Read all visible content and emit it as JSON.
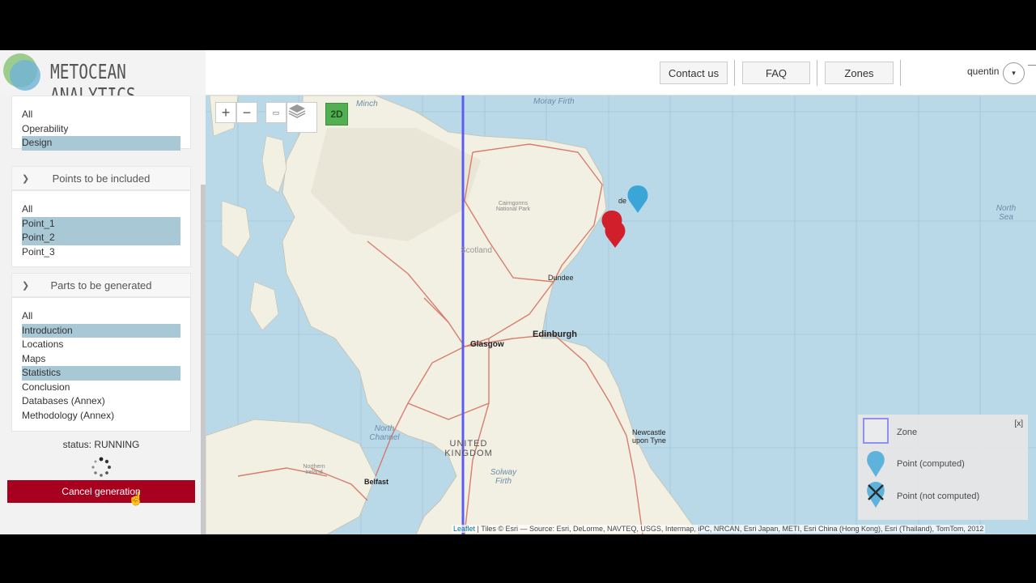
{
  "header": {
    "app_title": "METOCEAN ANALYTICS",
    "buttons": [
      "Contact us",
      "FAQ",
      "Zones"
    ],
    "username": "quentin"
  },
  "sidebar": {
    "type_options": [
      {
        "label": "All",
        "selected": false
      },
      {
        "label": "Operability",
        "selected": false
      },
      {
        "label": "Design",
        "selected": true
      }
    ],
    "points_panel": {
      "title": "Points to be included",
      "options": [
        {
          "label": "All",
          "selected": false
        },
        {
          "label": "Point_1",
          "selected": true
        },
        {
          "label": "Point_2",
          "selected": true
        },
        {
          "label": "Point_3",
          "selected": false
        }
      ]
    },
    "parts_panel": {
      "title": "Parts to be generated",
      "options": [
        {
          "label": "All",
          "selected": false
        },
        {
          "label": "Introduction",
          "selected": true
        },
        {
          "label": "Locations",
          "selected": false
        },
        {
          "label": "Maps",
          "selected": false
        },
        {
          "label": "Statistics",
          "selected": true
        },
        {
          "label": "Conclusion",
          "selected": false
        },
        {
          "label": "Databases (Annex)",
          "selected": false
        },
        {
          "label": "Methodology (Annex)",
          "selected": false
        }
      ]
    },
    "status_text": "status: RUNNING",
    "cancel_label": "Cancel generation"
  },
  "map": {
    "controls": {
      "zoom_in": "+",
      "zoom_out": "−",
      "mode_label": "2D"
    },
    "place_labels": {
      "dundee": "Dundee",
      "edinburgh": "Edinburgh",
      "glasgow": "Glasgow",
      "scotland": "Scotland",
      "cairngorms": "Cairngorms National Park",
      "newcastle": "Newcastle upon Tyne",
      "belfast": "Belfast",
      "united_kingdom": "UNITED KINGDOM",
      "northern_ireland": "Northern Ireland",
      "aberdeen_partial": "de"
    },
    "sea_labels": {
      "north_sea": "North Sea",
      "north_channel": "North Channel",
      "solway_firth": "Solway Firth",
      "moray_firth": "Moray Firth",
      "minch": "Minch"
    },
    "legend": {
      "close_label": "[x]",
      "items": [
        {
          "label": "Zone",
          "icon": "zone-square-icon"
        },
        {
          "label": "Point (computed)",
          "icon": "blue-marker-icon"
        },
        {
          "label": "Point (not computed)",
          "icon": "crossed-marker-icon"
        }
      ]
    },
    "attribution": {
      "leaflet": "Leaflet",
      "text": "| Tiles © Esri — Source: Esri, DeLorme, NAVTEQ, USGS, Intermap, iPC, NRCAN, Esri Japan, METI, Esri China (Hong Kong), Esri (Thailand), TomTom, 2012"
    },
    "colors": {
      "sea": "#b9d9e9",
      "land": "#f2efe3",
      "road": "#d26a5a",
      "zone_line": "#5c5cf0",
      "marker_red": "#d1202c",
      "marker_blue": "#3aa6d8"
    }
  }
}
